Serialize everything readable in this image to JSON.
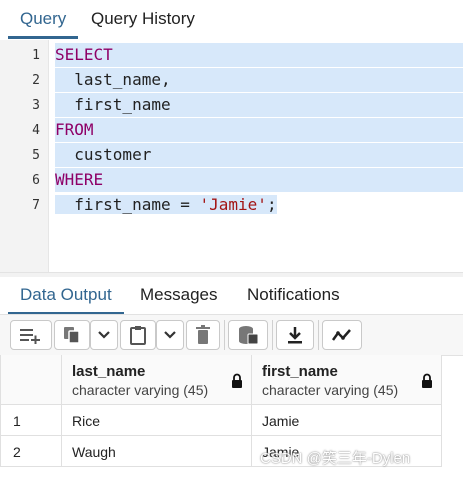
{
  "tabs": [
    {
      "label": "Query",
      "active": true
    },
    {
      "label": "Query History",
      "active": false
    }
  ],
  "editor": {
    "line_numbers": [
      "1",
      "2",
      "3",
      "4",
      "5",
      "6",
      "7"
    ],
    "lines": [
      {
        "kw": "SELECT",
        "text": ""
      },
      {
        "kw": "",
        "text": "  last_name,"
      },
      {
        "kw": "",
        "text": "  first_name"
      },
      {
        "kw": "FROM",
        "text": ""
      },
      {
        "kw": "",
        "text": "  customer"
      },
      {
        "kw": "WHERE",
        "text": ""
      },
      {
        "kw": "",
        "text": "  first_name = ",
        "str": "'Jamie'",
        "tail": ";"
      }
    ]
  },
  "output_tabs": [
    {
      "label": "Data Output",
      "active": true
    },
    {
      "label": "Messages",
      "active": false
    },
    {
      "label": "Notifications",
      "active": false
    }
  ],
  "toolbar": {
    "icons": [
      "add-row-icon",
      "copy-icon",
      "chevron-down-icon",
      "paste-icon",
      "chevron-down-icon",
      "delete-icon",
      "save-data-icon",
      "download-icon",
      "graph-icon"
    ]
  },
  "grid": {
    "columns": [
      {
        "name": "last_name",
        "type": "character varying (45)"
      },
      {
        "name": "first_name",
        "type": "character varying (45)"
      }
    ],
    "rows": [
      {
        "num": "1",
        "cells": [
          "Rice",
          "Jamie"
        ]
      },
      {
        "num": "2",
        "cells": [
          "Waugh",
          "Jamie"
        ]
      }
    ]
  },
  "watermark": "CSDN @笑三年-Dylen",
  "colors": {
    "accent": "#326690",
    "keyword": "#8e0067",
    "string": "#a31515",
    "selection": "#d7e8fa"
  }
}
